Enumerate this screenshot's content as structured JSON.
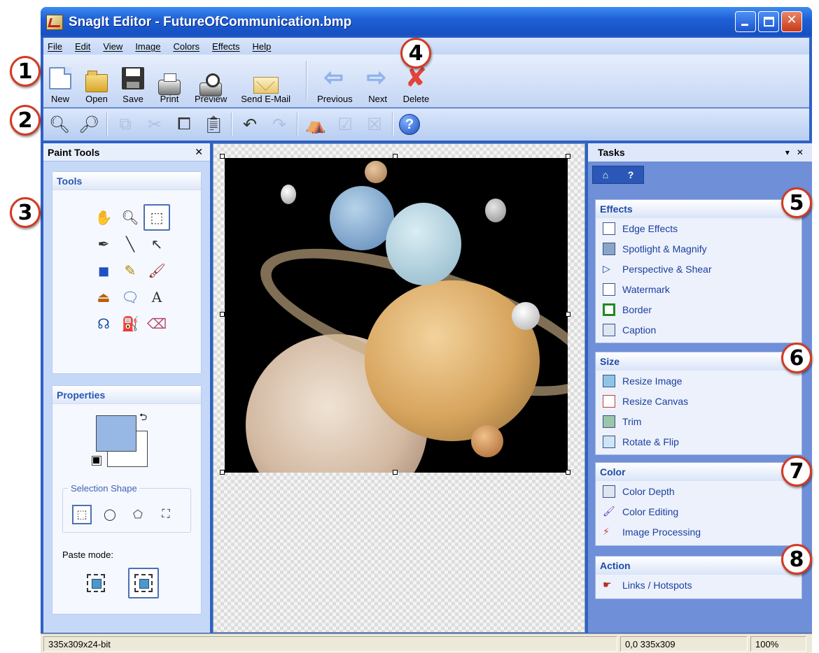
{
  "window": {
    "title": "SnagIt Editor - FutureOfCommunication.bmp"
  },
  "menu": [
    "File",
    "Edit",
    "View",
    "Image",
    "Colors",
    "Effects",
    "Help"
  ],
  "toolbar": {
    "new": "New",
    "open": "Open",
    "save": "Save",
    "print": "Print",
    "preview": "Preview",
    "send_email": "Send E-Mail",
    "previous": "Previous",
    "next": "Next",
    "delete": "Delete"
  },
  "paint_tools": {
    "title": "Paint Tools",
    "tools_title": "Tools",
    "properties_title": "Properties",
    "selection_shape_label": "Selection Shape",
    "paste_mode_label": "Paste mode:",
    "text_tool_glyph": "A"
  },
  "tasks": {
    "title": "Tasks",
    "effects": {
      "title": "Effects",
      "items": [
        "Edge Effects",
        "Spotlight & Magnify",
        "Perspective & Shear",
        "Watermark",
        "Border",
        "Caption"
      ]
    },
    "size": {
      "title": "Size",
      "items": [
        "Resize Image",
        "Resize Canvas",
        "Trim",
        "Rotate & Flip"
      ]
    },
    "color": {
      "title": "Color",
      "items": [
        "Color Depth",
        "Color Editing",
        "Image Processing"
      ]
    },
    "action": {
      "title": "Action",
      "items": [
        "Links / Hotspots"
      ]
    }
  },
  "status": {
    "image_info": "335x309x24-bit",
    "coords": "0,0  335x309",
    "zoom": "100%"
  },
  "callouts": [
    "1",
    "2",
    "3",
    "4",
    "5",
    "6",
    "7",
    "8"
  ],
  "colors": {
    "foreground": "#97b7e4",
    "background": "#ffffff",
    "accent": "#d23a22"
  }
}
